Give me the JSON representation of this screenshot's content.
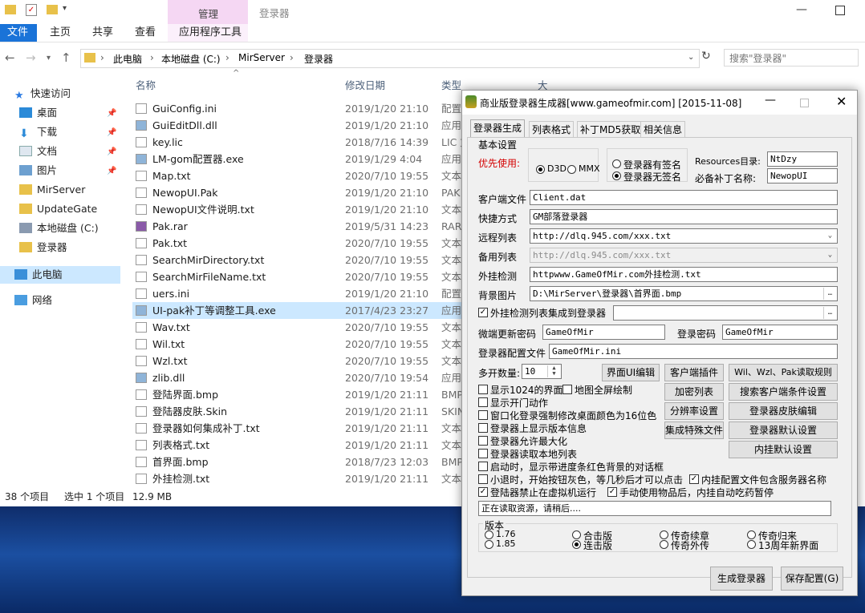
{
  "explorer": {
    "window_title": "登录器",
    "manage_tab": "管理",
    "ribbon_tabs": [
      "文件",
      "主页",
      "共享",
      "查看",
      "应用程序工具"
    ],
    "breadcrumb": [
      "此电脑",
      "本地磁盘 (C:)",
      "MirServer",
      "登录器"
    ],
    "search_placeholder": "搜索\"登录器\"",
    "columns": {
      "name": "名称",
      "date": "修改日期",
      "type": "类型",
      "size": "大小"
    },
    "sidebar": {
      "quick_access": "快速访问",
      "items": [
        "桌面",
        "下载",
        "文档",
        "图片",
        "MirServer",
        "UpdateGate",
        "本地磁盘 (C:)",
        "登录器"
      ],
      "this_pc": "此电脑",
      "network": "网络"
    },
    "files": [
      {
        "name": "GuiConfig.ini",
        "date": "2019/1/20 21:10",
        "type": "配置"
      },
      {
        "name": "GuiEditDll.dll",
        "date": "2019/1/20 21:10",
        "type": "应用"
      },
      {
        "name": "key.lic",
        "date": "2018/7/16 14:39",
        "type": "LIC 文"
      },
      {
        "name": "LM-gom配置器.exe",
        "date": "2019/1/29 4:04",
        "type": "应用"
      },
      {
        "name": "Map.txt",
        "date": "2020/7/10 19:55",
        "type": "文本"
      },
      {
        "name": "NewopUI.Pak",
        "date": "2019/1/20 21:10",
        "type": "PAK"
      },
      {
        "name": "NewopUI文件说明.txt",
        "date": "2019/1/20 21:10",
        "type": "文本"
      },
      {
        "name": "Pak.rar",
        "date": "2019/5/31 14:23",
        "type": "RAR"
      },
      {
        "name": "Pak.txt",
        "date": "2020/7/10 19:55",
        "type": "文本"
      },
      {
        "name": "SearchMirDirectory.txt",
        "date": "2020/7/10 19:55",
        "type": "文本"
      },
      {
        "name": "SearchMirFileName.txt",
        "date": "2020/7/10 19:55",
        "type": "文本"
      },
      {
        "name": "uers.ini",
        "date": "2019/1/20 21:10",
        "type": "配置"
      },
      {
        "name": "UI-pak补丁等调整工具.exe",
        "date": "2017/4/23 23:27",
        "type": "应用"
      },
      {
        "name": "Wav.txt",
        "date": "2020/7/10 19:55",
        "type": "文本"
      },
      {
        "name": "Wil.txt",
        "date": "2020/7/10 19:55",
        "type": "文本"
      },
      {
        "name": "Wzl.txt",
        "date": "2020/7/10 19:55",
        "type": "文本"
      },
      {
        "name": "zlib.dll",
        "date": "2020/7/10 19:54",
        "type": "应用"
      },
      {
        "name": "登陆界面.bmp",
        "date": "2019/1/20 21:11",
        "type": "BMP"
      },
      {
        "name": "登陆器皮肤.Skin",
        "date": "2019/1/20 21:11",
        "type": "SKIN"
      },
      {
        "name": "登录器如何集成补丁.txt",
        "date": "2019/1/20 21:11",
        "type": "文本"
      },
      {
        "name": "列表格式.txt",
        "date": "2019/1/20 21:11",
        "type": "文本"
      },
      {
        "name": "首界面.bmp",
        "date": "2018/7/23 12:03",
        "type": "BMP"
      },
      {
        "name": "外挂检测.txt",
        "date": "2019/1/20 21:11",
        "type": "文本"
      }
    ],
    "status": {
      "count": "38 个项目",
      "selected": "选中 1 个项目",
      "size": "12.9 MB"
    }
  },
  "dialog": {
    "title": "商业版登录器生成器[www.gameofmir.com] [2015-11-08]",
    "tabs": [
      "登录器生成",
      "列表格式",
      "补丁MD5获取",
      "相关信息"
    ],
    "basic_settings": "基本设置",
    "priority_label": "优先使用:",
    "d3d": "D3D",
    "mmx": "MMX",
    "sig_yes": "登录器有签名",
    "sig_no": "登录器无签名",
    "resources_label": "Resources目录:",
    "resources_value": "NtDzy",
    "patch_label": "必备补丁名称:",
    "patch_value": "NewopUI",
    "client_file_label": "客户端文件",
    "client_file_value": "Client.dat",
    "shortcut_label": "快捷方式",
    "shortcut_value": "GM部落登录器",
    "remote_list_label": "远程列表",
    "remote_list_value": "http://dlq.945.com/xxx.txt",
    "backup_list_label": "备用列表",
    "backup_list_value": "http://dlq.945.com/xxx.txt",
    "plugin_check_label": "外挂检测",
    "plugin_check_value": "httpwww.GameOfMir.com外挂检测.txt",
    "bg_image_label": "背景图片",
    "bg_image_value": "D:\\MirServer\\登录器\\首界面.bmp",
    "integrate_list": "外挂检测列表集成到登录器",
    "update_pwd_label": "微端更新密码",
    "update_pwd_value": "GameOfMir",
    "login_pwd_label": "登录密码",
    "login_pwd_value": "GameOfMir",
    "config_file_label": "登录器配置文件",
    "config_file_value": "GameOfMir.ini",
    "multi_label": "多开数量:",
    "multi_value": "10",
    "buttons": {
      "ui_edit": "界面UI编辑",
      "client_plugin": "客户端插件",
      "wil_rule": "Wil、Wzl、Pak读取规则",
      "encrypt_list": "加密列表",
      "search_client": "搜索客户端条件设置",
      "resolution": "分辨率设置",
      "skin_edit": "登录器皮肤编辑",
      "integrate_file": "集成特殊文件",
      "default_settings": "登录器默认设置",
      "hang_default": "内挂默认设置",
      "generate": "生成登录器",
      "save": "保存配置(G)"
    },
    "checks": {
      "ui1024": "显示1024的界面",
      "fullscreen": "地图全屏绘制",
      "door_anim": "显示开门动作",
      "win16": "窗口化登录强制修改桌面颜色为16位色",
      "show_version": "登录器上显示版本信息",
      "allow_max": "登录器允许最大化",
      "read_local": "登录器读取本地列表",
      "red_progress": "启动时，显示带进度条红色背景的对话框",
      "quick_exit": "小退时，开始按钮灰色，等几秒后才可以点击",
      "hang_server": "内挂配置文件包含服务器名称",
      "no_vm": "登陆器禁止在虚拟机运行",
      "auto_drug": "手动使用物品后，内挂自动吃药暂停"
    },
    "status_text": "正在读取资源，请稍后....",
    "version_label": "版本",
    "versions": [
      "1.76",
      "1.85",
      "合击版",
      "连击版",
      "传奇续章",
      "传奇外传",
      "传奇归来",
      "13周年新界面"
    ],
    "accent_red": "#d40000"
  }
}
